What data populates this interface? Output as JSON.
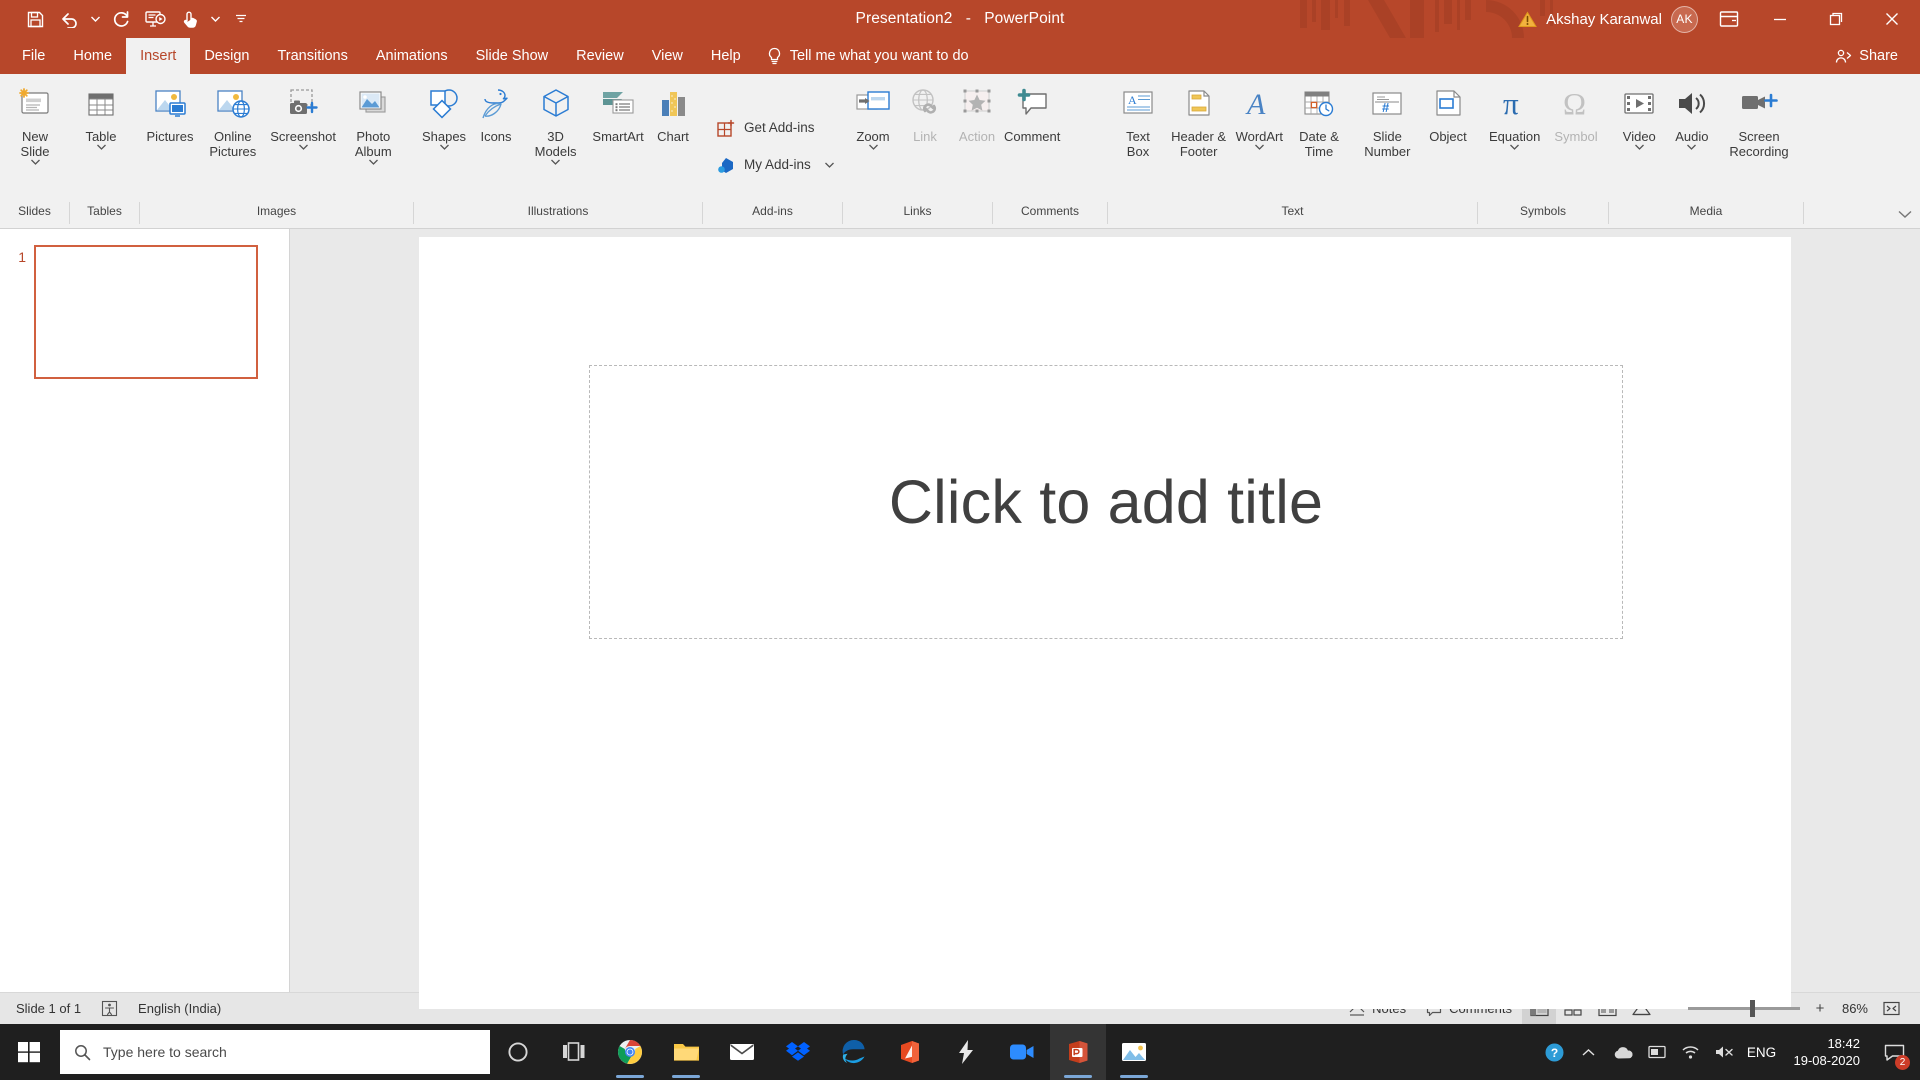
{
  "titlebar": {
    "document_title": "Presentation2",
    "app_name": "PowerPoint",
    "title_separator": "-",
    "quick_access": [
      {
        "name": "save",
        "label": "Save",
        "icon": "save-icon"
      },
      {
        "name": "undo",
        "label": "Undo",
        "icon": "undo-icon"
      },
      {
        "name": "redo",
        "label": "Redo",
        "icon": "redo-icon"
      },
      {
        "name": "start-from-beginning",
        "label": "Start From Beginning",
        "icon": "slideshow-icon"
      },
      {
        "name": "touch-mouse-mode",
        "label": "Touch/Mouse Mode",
        "icon": "touch-icon"
      },
      {
        "name": "customize-qat",
        "label": "Customize Quick Access Toolbar",
        "icon": "chevron-down-icon"
      }
    ],
    "account_name": "Akshay Karanwal",
    "account_initials": "AK",
    "warning_icon": "warning-icon",
    "ribbon_display_options": "Ribbon Display Options",
    "minimize": "Minimize",
    "restore": "Restore Down",
    "close": "Close"
  },
  "tabs": [
    {
      "label": "File",
      "active": false
    },
    {
      "label": "Home",
      "active": false
    },
    {
      "label": "Insert",
      "active": true
    },
    {
      "label": "Design",
      "active": false
    },
    {
      "label": "Transitions",
      "active": false
    },
    {
      "label": "Animations",
      "active": false
    },
    {
      "label": "Slide Show",
      "active": false
    },
    {
      "label": "Review",
      "active": false
    },
    {
      "label": "View",
      "active": false
    },
    {
      "label": "Help",
      "active": false
    }
  ],
  "tell_me": {
    "placeholder": "Tell me what you want to do",
    "icon": "lightbulb-icon"
  },
  "share": {
    "label": "Share",
    "icon": "share-person-icon"
  },
  "ribbon": {
    "collapse_label": "Collapse the Ribbon",
    "groups": [
      {
        "name": "slides",
        "label": "Slides",
        "items": [
          {
            "name": "new-slide",
            "label": "New Slide",
            "icon": "new-slide-icon",
            "dropdown": true,
            "disabled": false,
            "size": "big"
          }
        ]
      },
      {
        "name": "tables",
        "label": "Tables",
        "items": [
          {
            "name": "table",
            "label": "Table",
            "icon": "table-icon",
            "dropdown": true,
            "disabled": false,
            "size": "big"
          }
        ]
      },
      {
        "name": "images",
        "label": "Images",
        "items": [
          {
            "name": "pictures",
            "label": "Pictures",
            "icon": "pictures-icon",
            "dropdown": false,
            "disabled": false,
            "size": "big"
          },
          {
            "name": "online-pictures",
            "label": "Online Pictures",
            "icon": "online-pictures-icon",
            "dropdown": false,
            "disabled": false,
            "size": "big"
          },
          {
            "name": "screenshot",
            "label": "Screenshot",
            "icon": "screenshot-icon",
            "dropdown": true,
            "disabled": false,
            "size": "big"
          },
          {
            "name": "photo-album",
            "label": "Photo Album",
            "icon": "photo-album-icon",
            "dropdown": true,
            "disabled": false,
            "size": "big"
          }
        ]
      },
      {
        "name": "illustrations",
        "label": "Illustrations",
        "items": [
          {
            "name": "shapes",
            "label": "Shapes",
            "icon": "shapes-icon",
            "dropdown": true,
            "disabled": false,
            "size": "big"
          },
          {
            "name": "icons",
            "label": "Icons",
            "icon": "icons-icon",
            "dropdown": false,
            "disabled": false,
            "size": "big"
          },
          {
            "name": "3d-models",
            "label": "3D Models",
            "icon": "cube-icon",
            "dropdown": true,
            "disabled": false,
            "size": "big"
          },
          {
            "name": "smartart",
            "label": "SmartArt",
            "icon": "smartart-icon",
            "dropdown": false,
            "disabled": false,
            "size": "big"
          },
          {
            "name": "chart",
            "label": "Chart",
            "icon": "chart-icon",
            "dropdown": false,
            "disabled": false,
            "size": "big"
          }
        ]
      },
      {
        "name": "add-ins",
        "label": "Add-ins",
        "items": [
          {
            "name": "get-add-ins",
            "label": "Get Add-ins",
            "icon": "store-icon",
            "dropdown": false,
            "disabled": false,
            "size": "small"
          },
          {
            "name": "my-add-ins",
            "label": "My Add-ins",
            "icon": "my-addins-icon",
            "dropdown": true,
            "disabled": false,
            "size": "small"
          }
        ]
      },
      {
        "name": "links",
        "label": "Links",
        "items": [
          {
            "name": "zoom",
            "label": "Zoom",
            "icon": "zoom-icon",
            "dropdown": true,
            "disabled": false,
            "size": "big"
          },
          {
            "name": "link",
            "label": "Link",
            "icon": "link-globe-icon",
            "dropdown": false,
            "disabled": true,
            "size": "big"
          },
          {
            "name": "action",
            "label": "Action",
            "icon": "action-star-icon",
            "dropdown": false,
            "disabled": true,
            "size": "big"
          }
        ]
      },
      {
        "name": "comments",
        "label": "Comments",
        "items": [
          {
            "name": "comment",
            "label": "Comment",
            "icon": "comment-icon",
            "dropdown": false,
            "disabled": false,
            "size": "big"
          }
        ]
      },
      {
        "name": "text",
        "label": "Text",
        "items": [
          {
            "name": "text-box",
            "label": "Text Box",
            "icon": "text-box-icon",
            "dropdown": false,
            "disabled": false,
            "size": "big"
          },
          {
            "name": "header-footer",
            "label": "Header & Footer",
            "icon": "header-footer-icon",
            "dropdown": false,
            "disabled": false,
            "size": "big"
          },
          {
            "name": "wordart",
            "label": "WordArt",
            "icon": "wordart-icon",
            "dropdown": true,
            "disabled": false,
            "size": "big"
          },
          {
            "name": "date-time",
            "label": "Date & Time",
            "icon": "date-time-icon",
            "dropdown": false,
            "disabled": false,
            "size": "big"
          },
          {
            "name": "slide-number",
            "label": "Slide Number",
            "icon": "slide-number-icon",
            "dropdown": false,
            "disabled": false,
            "size": "big"
          },
          {
            "name": "object",
            "label": "Object",
            "icon": "object-icon",
            "dropdown": false,
            "disabled": false,
            "size": "big"
          }
        ]
      },
      {
        "name": "symbols",
        "label": "Symbols",
        "items": [
          {
            "name": "equation",
            "label": "Equation",
            "icon": "pi-icon",
            "dropdown": true,
            "disabled": false,
            "size": "big"
          },
          {
            "name": "symbol",
            "label": "Symbol",
            "icon": "omega-icon",
            "dropdown": false,
            "disabled": true,
            "size": "big"
          }
        ]
      },
      {
        "name": "media",
        "label": "Media",
        "items": [
          {
            "name": "video",
            "label": "Video",
            "icon": "video-icon",
            "dropdown": true,
            "disabled": false,
            "size": "big"
          },
          {
            "name": "audio",
            "label": "Audio",
            "icon": "audio-icon",
            "dropdown": true,
            "disabled": false,
            "size": "big"
          },
          {
            "name": "screen-recording",
            "label": "Screen Recording",
            "icon": "screen-recording-icon",
            "dropdown": false,
            "disabled": false,
            "size": "big"
          }
        ]
      }
    ]
  },
  "slides_pane": {
    "slides": [
      {
        "number": "1"
      }
    ]
  },
  "slide": {
    "title_placeholder": "Click to add title"
  },
  "statusbar": {
    "slide_count": "Slide 1 of 1",
    "accessibility_icon": "accessibility-icon",
    "language": "English (India)",
    "notes_label": "Notes",
    "notes_icon": "notes-icon",
    "comments_label": "Comments",
    "comments_icon": "comments-icon",
    "views": [
      {
        "name": "normal-view",
        "icon": "normal-view-icon",
        "active": true
      },
      {
        "name": "slide-sorter-view",
        "icon": "slide-sorter-icon",
        "active": false
      },
      {
        "name": "reading-view",
        "icon": "reading-view-icon",
        "active": false
      },
      {
        "name": "slide-show-view",
        "icon": "slide-show-icon",
        "active": false
      }
    ],
    "zoom_out": "−",
    "zoom_in": "+",
    "zoom_value": "86%",
    "fit_to_window_icon": "fit-window-icon"
  },
  "taskbar": {
    "start_icon": "windows-start-icon",
    "search_placeholder": "Type here to search",
    "search_icon": "search-icon",
    "items": [
      {
        "name": "cortana",
        "icon": "cortana-circle-icon",
        "running": false,
        "active": false
      },
      {
        "name": "task-view",
        "icon": "task-view-icon",
        "running": false,
        "active": false
      },
      {
        "name": "google-chrome",
        "icon": "chrome-icon",
        "running": true,
        "active": false
      },
      {
        "name": "file-explorer",
        "icon": "file-explorer-icon",
        "running": true,
        "active": false
      },
      {
        "name": "mail",
        "icon": "mail-icon",
        "running": false,
        "active": false
      },
      {
        "name": "dropbox",
        "icon": "dropbox-icon",
        "running": false,
        "active": false
      },
      {
        "name": "microsoft-edge",
        "icon": "edge-icon",
        "running": false,
        "active": false
      },
      {
        "name": "office",
        "icon": "office-icon",
        "running": false,
        "active": false
      },
      {
        "name": "bolt-app",
        "icon": "bolt-icon",
        "running": false,
        "active": false
      },
      {
        "name": "zoom-meetings",
        "icon": "video-camera-icon",
        "running": false,
        "active": false
      },
      {
        "name": "powerpoint",
        "icon": "powerpoint-icon",
        "running": true,
        "active": true
      },
      {
        "name": "photos",
        "icon": "photos-icon",
        "running": true,
        "active": false
      }
    ],
    "tray": [
      {
        "name": "help-support",
        "icon": "question-circle-icon"
      },
      {
        "name": "show-hidden-icons",
        "icon": "chevron-up-icon"
      },
      {
        "name": "onedrive",
        "icon": "cloud-icon"
      },
      {
        "name": "action-center-tray",
        "icon": "tray-window-icon"
      },
      {
        "name": "network",
        "icon": "wifi-icon"
      },
      {
        "name": "volume",
        "icon": "speaker-mute-icon"
      },
      {
        "name": "language",
        "label": "ENG"
      }
    ],
    "clock_time": "18:42",
    "clock_date": "19-08-2020",
    "notification_count": "2",
    "notification_icon": "notification-icon"
  },
  "colors": {
    "accent": "#b7472a",
    "ribbon_bg": "#f1f1f1",
    "slide_bg": "#e9e9e9",
    "taskbar": "#1f1f1f"
  }
}
